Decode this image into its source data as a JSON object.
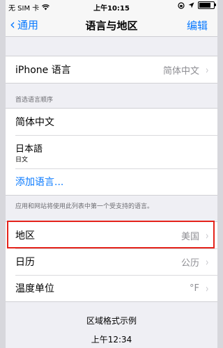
{
  "status_bar": {
    "carrier": "无 SIM 卡",
    "time": "上午10:15"
  },
  "nav": {
    "back_label": "通用",
    "title": "语言与地区",
    "edit_label": "编辑"
  },
  "iphone_language": {
    "label": "iPhone 语言",
    "value": "简体中文"
  },
  "preferred": {
    "header": "首选语言顺序",
    "languages": [
      {
        "name": "简体中文",
        "sub": ""
      },
      {
        "name": "日本語",
        "sub": "日文"
      }
    ],
    "add_label": "添加语言...",
    "footer": "应用和网站将使用此列表中第一个受支持的语言。"
  },
  "settings": {
    "region": {
      "label": "地区",
      "value": "美国"
    },
    "calendar": {
      "label": "日历",
      "value": "公历"
    },
    "temperature": {
      "label": "温度单位",
      "value": "°F"
    }
  },
  "format_example": {
    "title": "区域格式示例",
    "time": "上午12:34"
  },
  "colors": {
    "accent": "#0a7aff",
    "highlight": "#e5231b"
  }
}
